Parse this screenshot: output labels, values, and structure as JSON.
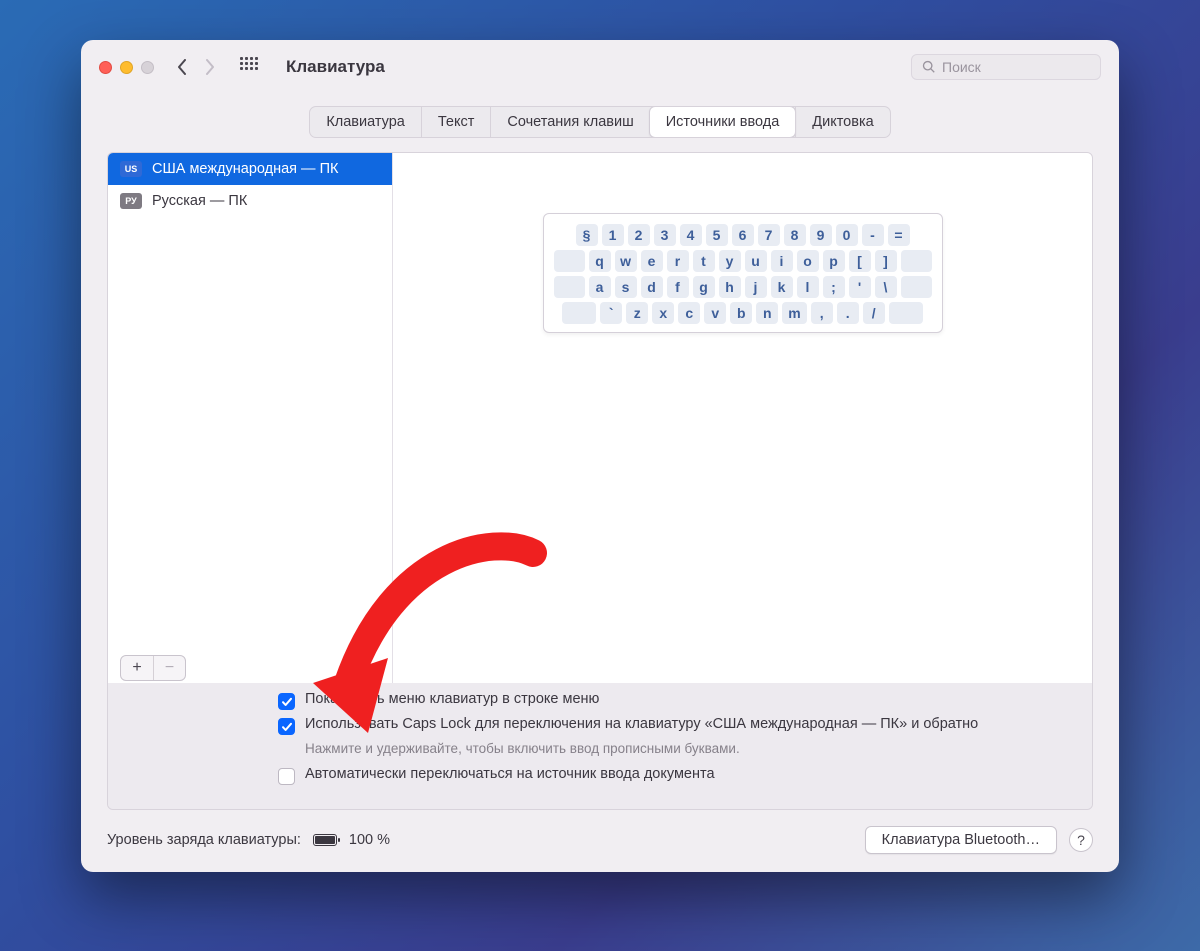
{
  "header": {
    "title": "Клавиатура",
    "search_placeholder": "Поиск"
  },
  "tabs": {
    "items": [
      "Клавиатура",
      "Текст",
      "Сочетания клавиш",
      "Источники ввода",
      "Диктовка"
    ],
    "active_index": 3
  },
  "sources": {
    "items": [
      {
        "flag": "US",
        "label": "США международная — ПК",
        "selected": true
      },
      {
        "flag": "РУ",
        "label": "Русская — ПК",
        "selected": false
      }
    ]
  },
  "keyboard_preview": {
    "rows": [
      [
        "§",
        "1",
        "2",
        "3",
        "4",
        "5",
        "6",
        "7",
        "8",
        "9",
        "0",
        "-",
        "="
      ],
      [
        "q",
        "w",
        "e",
        "r",
        "t",
        "y",
        "u",
        "i",
        "o",
        "p",
        "[",
        "]"
      ],
      [
        "a",
        "s",
        "d",
        "f",
        "g",
        "h",
        "j",
        "k",
        "l",
        ";",
        "'",
        "\\"
      ],
      [
        "`",
        "z",
        "x",
        "c",
        "v",
        "b",
        "n",
        "m",
        ",",
        ".",
        "/"
      ]
    ]
  },
  "options": {
    "show_menu": {
      "checked": true,
      "label": "Показывать меню клавиатур в строке меню"
    },
    "caps_lock": {
      "checked": true,
      "label": "Использовать Caps Lock для переключения на клавиатуру «США международная — ПК» и обратно",
      "hint": "Нажмите и удерживайте, чтобы включить ввод прописными буквами."
    },
    "auto_switch": {
      "checked": false,
      "label": "Автоматически переключаться на источник ввода документа"
    }
  },
  "footer": {
    "battery_label": "Уровень заряда клавиатуры:",
    "battery_pct": "100 %",
    "bluetooth_btn": "Клавиатура Bluetooth…",
    "help": "?"
  }
}
